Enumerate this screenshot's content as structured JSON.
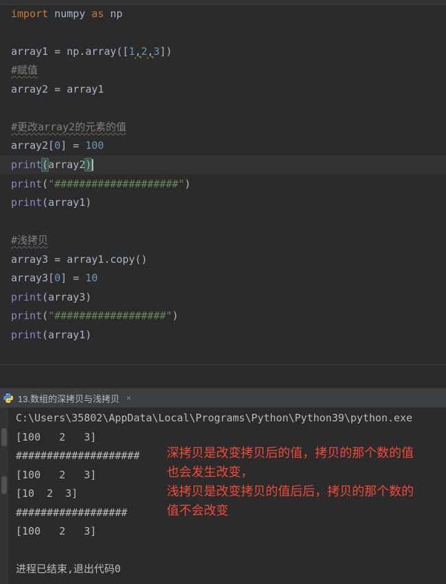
{
  "editor": {
    "line1": {
      "kw_import": "import",
      "mod": " numpy ",
      "kw_as": "as",
      "alias": " np"
    },
    "line3": {
      "a": "array1 = np.array([",
      "n1": "1",
      "c1": ",",
      "n2": "2",
      "c2": ",",
      "n3": "3",
      "b": "])"
    },
    "line4": {
      "comment": "#赋值"
    },
    "line5": {
      "text": "array2 = array1"
    },
    "line7": {
      "comment": "#更改array2的元素的值"
    },
    "line8": {
      "a": "array2[",
      "idx": "0",
      "b": "] = ",
      "val": "100"
    },
    "line9": {
      "fn": "print",
      "open": "(",
      "arg": "array2",
      "close": ")"
    },
    "line10": {
      "fn": "print",
      "open": "(",
      "str": "\"####################\"",
      "close": ")"
    },
    "line11": {
      "fn": "print",
      "rest": "(array1)"
    },
    "line13": {
      "comment": "#浅拷贝"
    },
    "line14": {
      "text": "array3 = array1.copy()"
    },
    "line15": {
      "a": "array3[",
      "idx": "0",
      "b": "] = ",
      "val": "10"
    },
    "line16": {
      "fn": "print",
      "rest": "(array3)"
    },
    "line17": {
      "fn": "print",
      "open": "(",
      "str": "\"##################\"",
      "close": ")"
    },
    "line18": {
      "fn": "print",
      "rest": "(array1)"
    }
  },
  "run_tab": {
    "label": "13.数组的深拷贝与浅拷贝",
    "close": "×",
    "icon": "python-icon"
  },
  "console": {
    "lines": [
      "C:\\Users\\35802\\AppData\\Local\\Programs\\Python\\Python39\\python.exe",
      "[100   2   3]",
      "####################",
      "[100   2   3]",
      "[10  2  3]",
      "##################",
      "[100   2   3]",
      "",
      "进程已结束,退出代码0"
    ]
  },
  "annotation": {
    "line1": "深拷贝是改变拷贝后的值，拷贝的那个数的值",
    "line2": "也会发生改变，",
    "line3": "浅拷贝是改变拷贝的值后后，拷贝的那个数的",
    "line4": "值不会改变"
  },
  "colors": {
    "background": "#2b2b2b",
    "keyword": "#cc7832",
    "number": "#6897bb",
    "string": "#6a8759",
    "builtin": "#8888c6",
    "comment": "#808080",
    "annotation": "#f04a3a"
  }
}
